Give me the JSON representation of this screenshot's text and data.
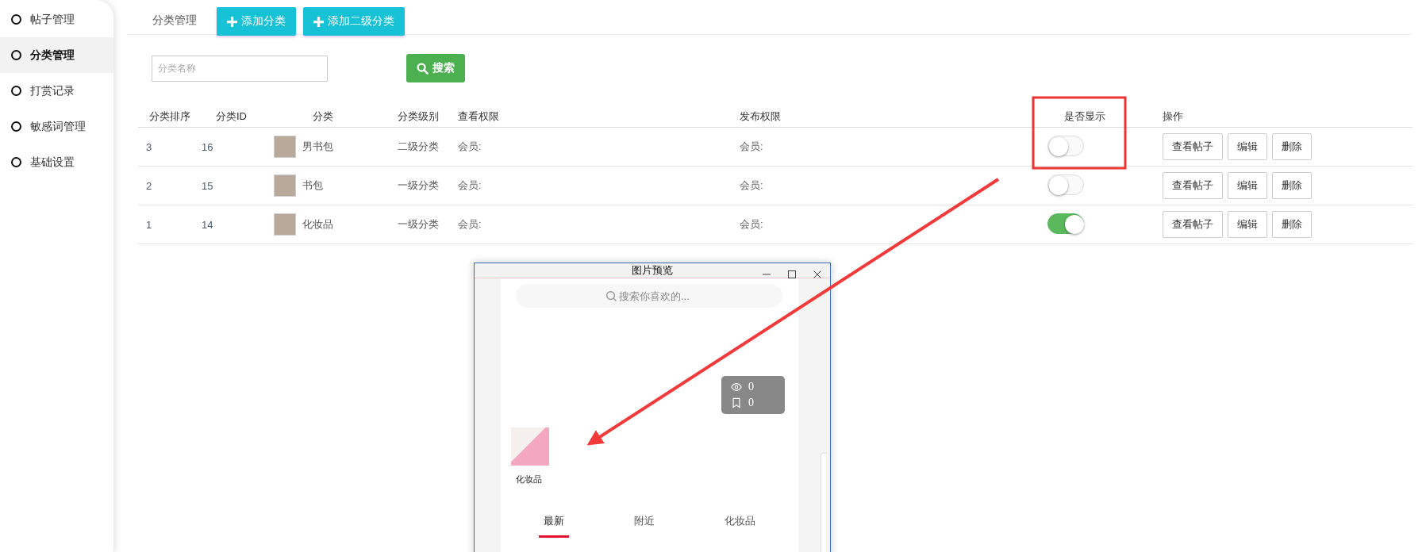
{
  "sidebar": {
    "items": [
      {
        "label": "帖子管理",
        "selected": false
      },
      {
        "label": "分类管理",
        "selected": true
      },
      {
        "label": "打赏记录",
        "selected": false
      },
      {
        "label": "敏感词管理",
        "selected": false
      },
      {
        "label": "基础设置",
        "selected": false
      }
    ]
  },
  "toolbar": {
    "title": "分类管理",
    "buttons": [
      "添加分类",
      "添加二级分类"
    ]
  },
  "search": {
    "placeholder": "分类名称",
    "button": "搜索"
  },
  "table": {
    "columns": [
      "分类排序",
      "分类ID",
      "分类",
      "分类级别",
      "查看权限",
      "发布权限",
      "是否显示",
      "操作"
    ],
    "rows": [
      {
        "sort": "3",
        "id": "16",
        "name": "男书包",
        "level": "二级分类",
        "view_permission": "会员:",
        "post_permission": "会员:",
        "visible": false,
        "actions": [
          "查看帖子",
          "编辑",
          "删除"
        ]
      },
      {
        "sort": "2",
        "id": "15",
        "name": "书包",
        "level": "一级分类",
        "view_permission": "会员:",
        "post_permission": "会员:",
        "visible": false,
        "actions": [
          "查看帖子",
          "编辑",
          "删除"
        ]
      },
      {
        "sort": "1",
        "id": "14",
        "name": "化妆品",
        "level": "一级分类",
        "view_permission": "会员:",
        "post_permission": "会员:",
        "visible": true,
        "actions": [
          "查看帖子",
          "编辑",
          "删除"
        ]
      }
    ]
  },
  "preview_window": {
    "title": "图片预览",
    "search_placeholder": "搜索你喜欢的...",
    "views": "0",
    "bookmarks": "0",
    "category": "化妆品",
    "tabs": [
      {
        "label": "最新",
        "selected": true
      },
      {
        "label": "附近",
        "selected": false
      },
      {
        "label": "化妆品",
        "selected": false
      }
    ]
  }
}
